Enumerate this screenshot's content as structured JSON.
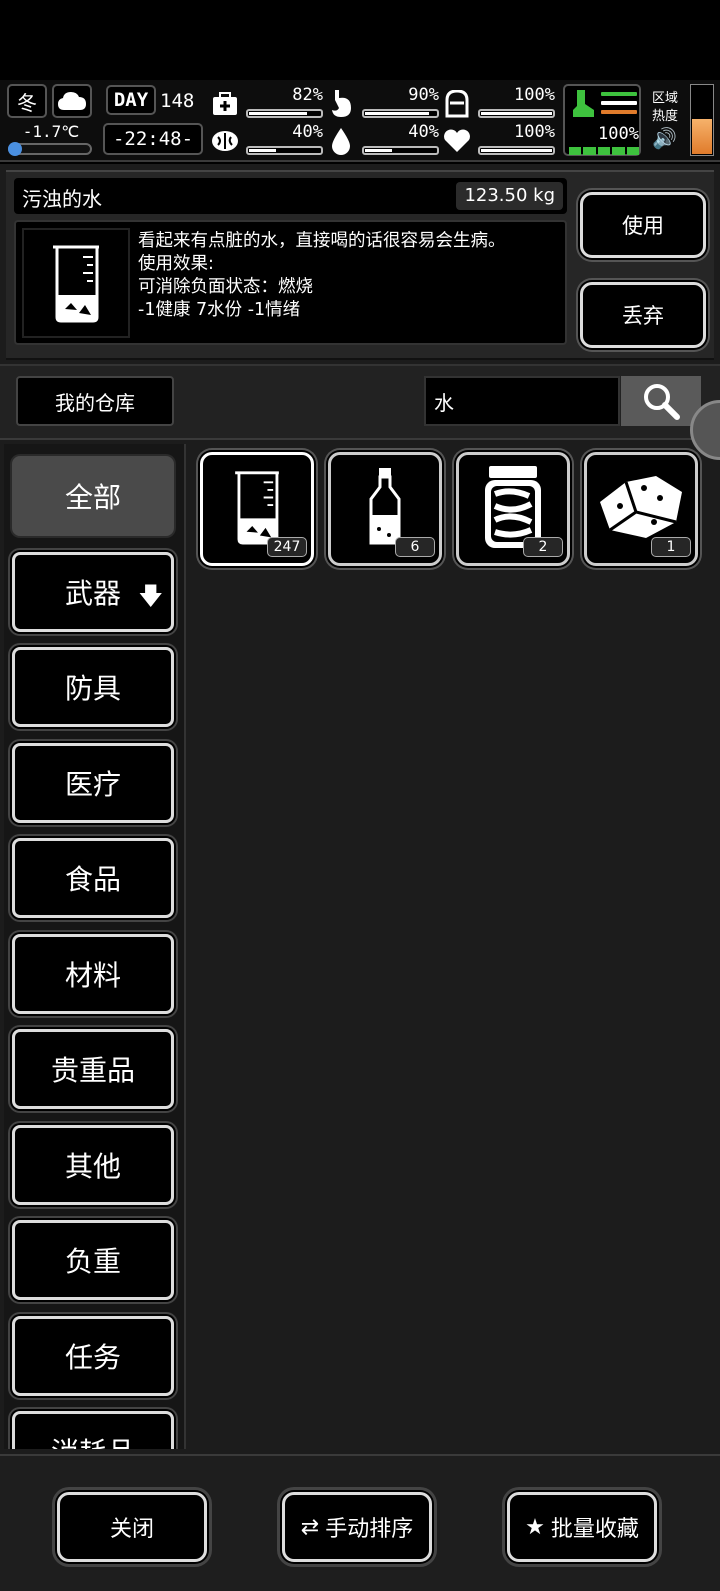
{
  "status": {
    "season": "冬",
    "temperature": "-1.7℃",
    "temperature_level": 0.12,
    "day_label": "DAY",
    "day_number": "148",
    "clock": "-22:48-",
    "stats": [
      {
        "key": "health",
        "icon": "medkit-icon",
        "pct": "82%",
        "value": 0.82
      },
      {
        "key": "hunger",
        "icon": "stomach-icon",
        "pct": "90%",
        "value": 0.9
      },
      {
        "key": "armor",
        "icon": "helmet-icon",
        "pct": "100%",
        "value": 1.0
      },
      {
        "key": "mind",
        "icon": "brain-icon",
        "pct": "40%",
        "value": 0.4
      },
      {
        "key": "water",
        "icon": "water-drop-icon",
        "pct": "40%",
        "value": 0.4
      },
      {
        "key": "mood",
        "icon": "heart-icon",
        "pct": "100%",
        "value": 1.0
      }
    ],
    "stamina_pct": "100%",
    "stamina_value": 1.0,
    "area_heat_label_1": "区域",
    "area_heat_label_2": "热度",
    "area_heat_value": 0.5,
    "colors": {
      "stamina": "#3ec23e",
      "temp": "#4a8fe0",
      "heat": "#e07b2b"
    }
  },
  "detail": {
    "name": "污浊的水",
    "weight": "123.50 kg",
    "description": "看起来有点脏的水，直接喝的话很容易会生病。\n使用效果:\n可消除负面状态：燃烧\n-1健康 7水份 -1情绪",
    "use_label": "使用",
    "drop_label": "丢弃"
  },
  "search": {
    "warehouse_label": "我的仓库",
    "value": "水"
  },
  "categories": [
    {
      "label": "全部",
      "active": true
    },
    {
      "label": "武器",
      "arrow": "🡇"
    },
    {
      "label": "防具"
    },
    {
      "label": "医疗"
    },
    {
      "label": "食品"
    },
    {
      "label": "材料"
    },
    {
      "label": "贵重品"
    },
    {
      "label": "其他"
    },
    {
      "label": "负重"
    },
    {
      "label": "任务"
    },
    {
      "label": "消耗品"
    }
  ],
  "items": [
    {
      "icon": "beaker-water-icon",
      "count": "247"
    },
    {
      "icon": "bottle-icon",
      "count": "6"
    },
    {
      "icon": "pickle-jar-icon",
      "count": "2"
    },
    {
      "icon": "sponge-icon",
      "count": "1"
    }
  ],
  "bottom": {
    "close_label": "关闭",
    "sort_label": "手动排序",
    "fav_label": "批量收藏"
  }
}
